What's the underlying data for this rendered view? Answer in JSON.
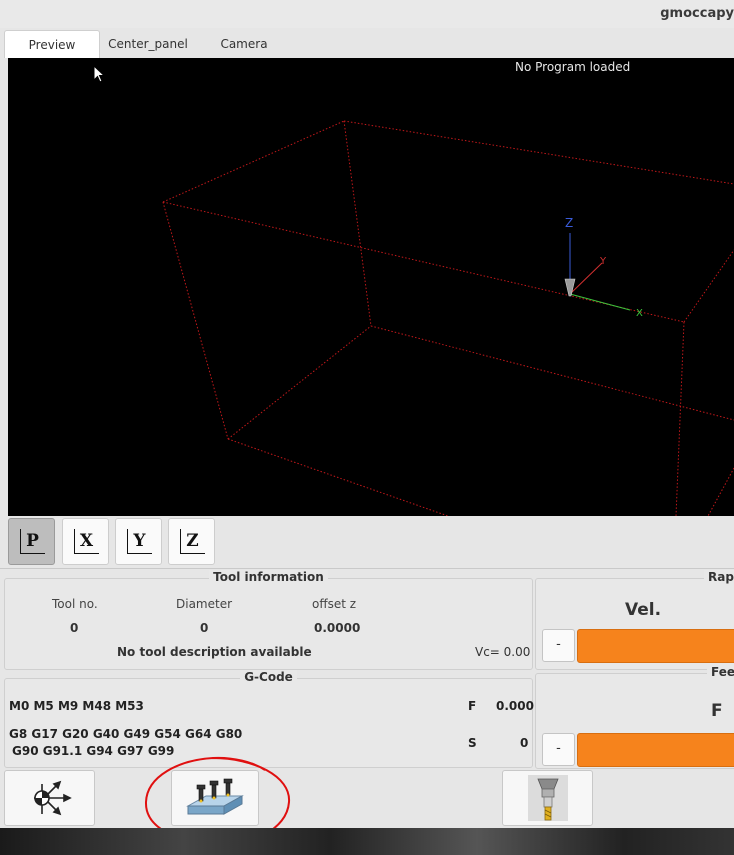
{
  "window": {
    "title": "gmoccapy"
  },
  "tabs": [
    {
      "label": "Preview",
      "active": true
    },
    {
      "label": "Center_panel",
      "active": false
    },
    {
      "label": "Camera",
      "active": false
    }
  ],
  "preview": {
    "status": "No Program loaded",
    "axis_labels": {
      "z": "Z",
      "x": "X",
      "y": "Y"
    }
  },
  "view_buttons": [
    {
      "label": "P",
      "icon": "view-perspective-icon",
      "active": true
    },
    {
      "label": "X",
      "icon": "view-x-icon",
      "active": false
    },
    {
      "label": "Y",
      "icon": "view-y-icon",
      "active": false
    },
    {
      "label": "Z",
      "icon": "view-z-icon",
      "active": false
    }
  ],
  "tool_info": {
    "title": "Tool information",
    "headers": {
      "tool_no": "Tool no.",
      "diameter": "Diameter",
      "offset_z": "offset z"
    },
    "values": {
      "tool_no": "0",
      "diameter": "0",
      "offset_z": "0.0000"
    },
    "description": "No tool description available",
    "vc": "Vc= 0.00"
  },
  "gcode": {
    "title": "G-Code",
    "mcodes": "M0 M5 M9 M48 M53",
    "gcodes_line1": "G8 G17 G20 G40 G49 G54 G64 G80",
    "gcodes_line2": "G90 G91.1 G94 G97 G99",
    "f_label": "F",
    "f_value": "0.000",
    "s_label": "S",
    "s_value": "0"
  },
  "rapid": {
    "title": "Rapi",
    "label": "Vel.",
    "minus": "-",
    "value": "1"
  },
  "feed": {
    "title": "Feed",
    "label": "F",
    "minus": "-",
    "value": "1"
  },
  "bottom_buttons": [
    {
      "icon": "touch-off-icon"
    },
    {
      "icon": "tool-measure-icon",
      "highlighted": true
    },
    {
      "icon": "spindle-tool-icon"
    }
  ],
  "colors": {
    "accent_orange": "#f6831c",
    "wireframe_red": "#c0181a",
    "annotation_red": "#e01010"
  }
}
